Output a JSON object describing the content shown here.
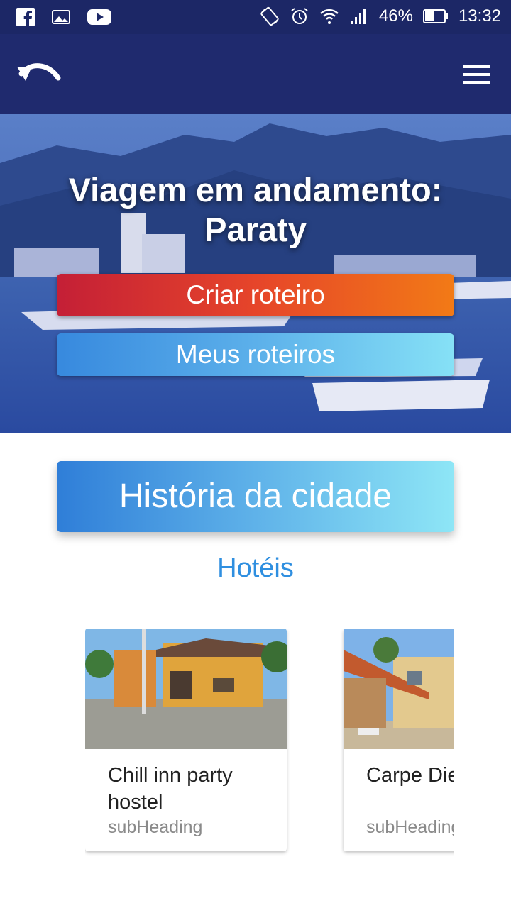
{
  "status_bar": {
    "left_icons": [
      "facebook-icon",
      "gallery-icon",
      "youtube-icon"
    ],
    "right_icons": [
      "rotate-icon",
      "alarm-icon",
      "wifi-icon",
      "signal-icon",
      "battery-icon"
    ],
    "battery_pct": "46%",
    "time": "13:32"
  },
  "app_bar": {
    "back_icon": "undo-arrow-icon",
    "menu_icon": "hamburger-menu-icon",
    "color": "#1f2a6e"
  },
  "hero": {
    "title_line1": "Viagem em andamento:",
    "title_line2": "Paraty",
    "create_label": "Criar roteiro",
    "my_label": "Meus roteiros"
  },
  "history_label": "História da cidade",
  "hotels_title": "Hotéis",
  "hotels": [
    {
      "title": "Chill inn party hostel",
      "subtitle": "subHeading"
    },
    {
      "title": "Carpe Diem Hostel",
      "subtitle": "subHeading"
    }
  ],
  "colors": {
    "status_bar": "#1c2766",
    "accent_blue": "#2f8fe0",
    "create_start": "#c41f36",
    "create_end": "#f27a16",
    "blue_start": "#3789de",
    "blue_end": "#86e1f6"
  }
}
